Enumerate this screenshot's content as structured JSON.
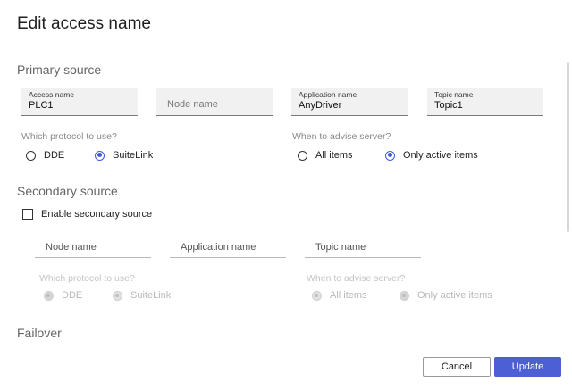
{
  "dialog": {
    "title": "Edit access name"
  },
  "primary": {
    "title": "Primary source",
    "access_name": {
      "label": "Access name",
      "value": "PLC1"
    },
    "node_name": {
      "placeholder": "Node name"
    },
    "application_name": {
      "label": "Application name",
      "value": "AnyDriver"
    },
    "topic_name": {
      "label": "Topic name",
      "value": "Topic1"
    },
    "protocol": {
      "question": "Which protocol to use?",
      "options": [
        "DDE",
        "SuiteLink"
      ],
      "selected": "SuiteLink"
    },
    "advise": {
      "question": "When to advise server?",
      "options": [
        "All items",
        "Only active items"
      ],
      "selected": "Only active items"
    }
  },
  "secondary": {
    "title": "Secondary source",
    "enable_label": "Enable secondary source",
    "enabled": false,
    "node_name": {
      "placeholder": "Node name"
    },
    "application_name": {
      "placeholder": "Application name"
    },
    "topic_name": {
      "placeholder": "Topic name"
    },
    "protocol": {
      "question": "Which protocol to use?",
      "options": [
        "DDE",
        "SuiteLink"
      ],
      "selected": "DDE"
    },
    "advise": {
      "question": "When to advise server?",
      "options": [
        "All items",
        "Only active items"
      ],
      "selected": "Only active items"
    }
  },
  "failover": {
    "title": "Failover"
  },
  "footer": {
    "cancel_label": "Cancel",
    "update_label": "Update"
  },
  "colors": {
    "accent": "#4c5fd5",
    "radio_selected": "#4158d6"
  }
}
